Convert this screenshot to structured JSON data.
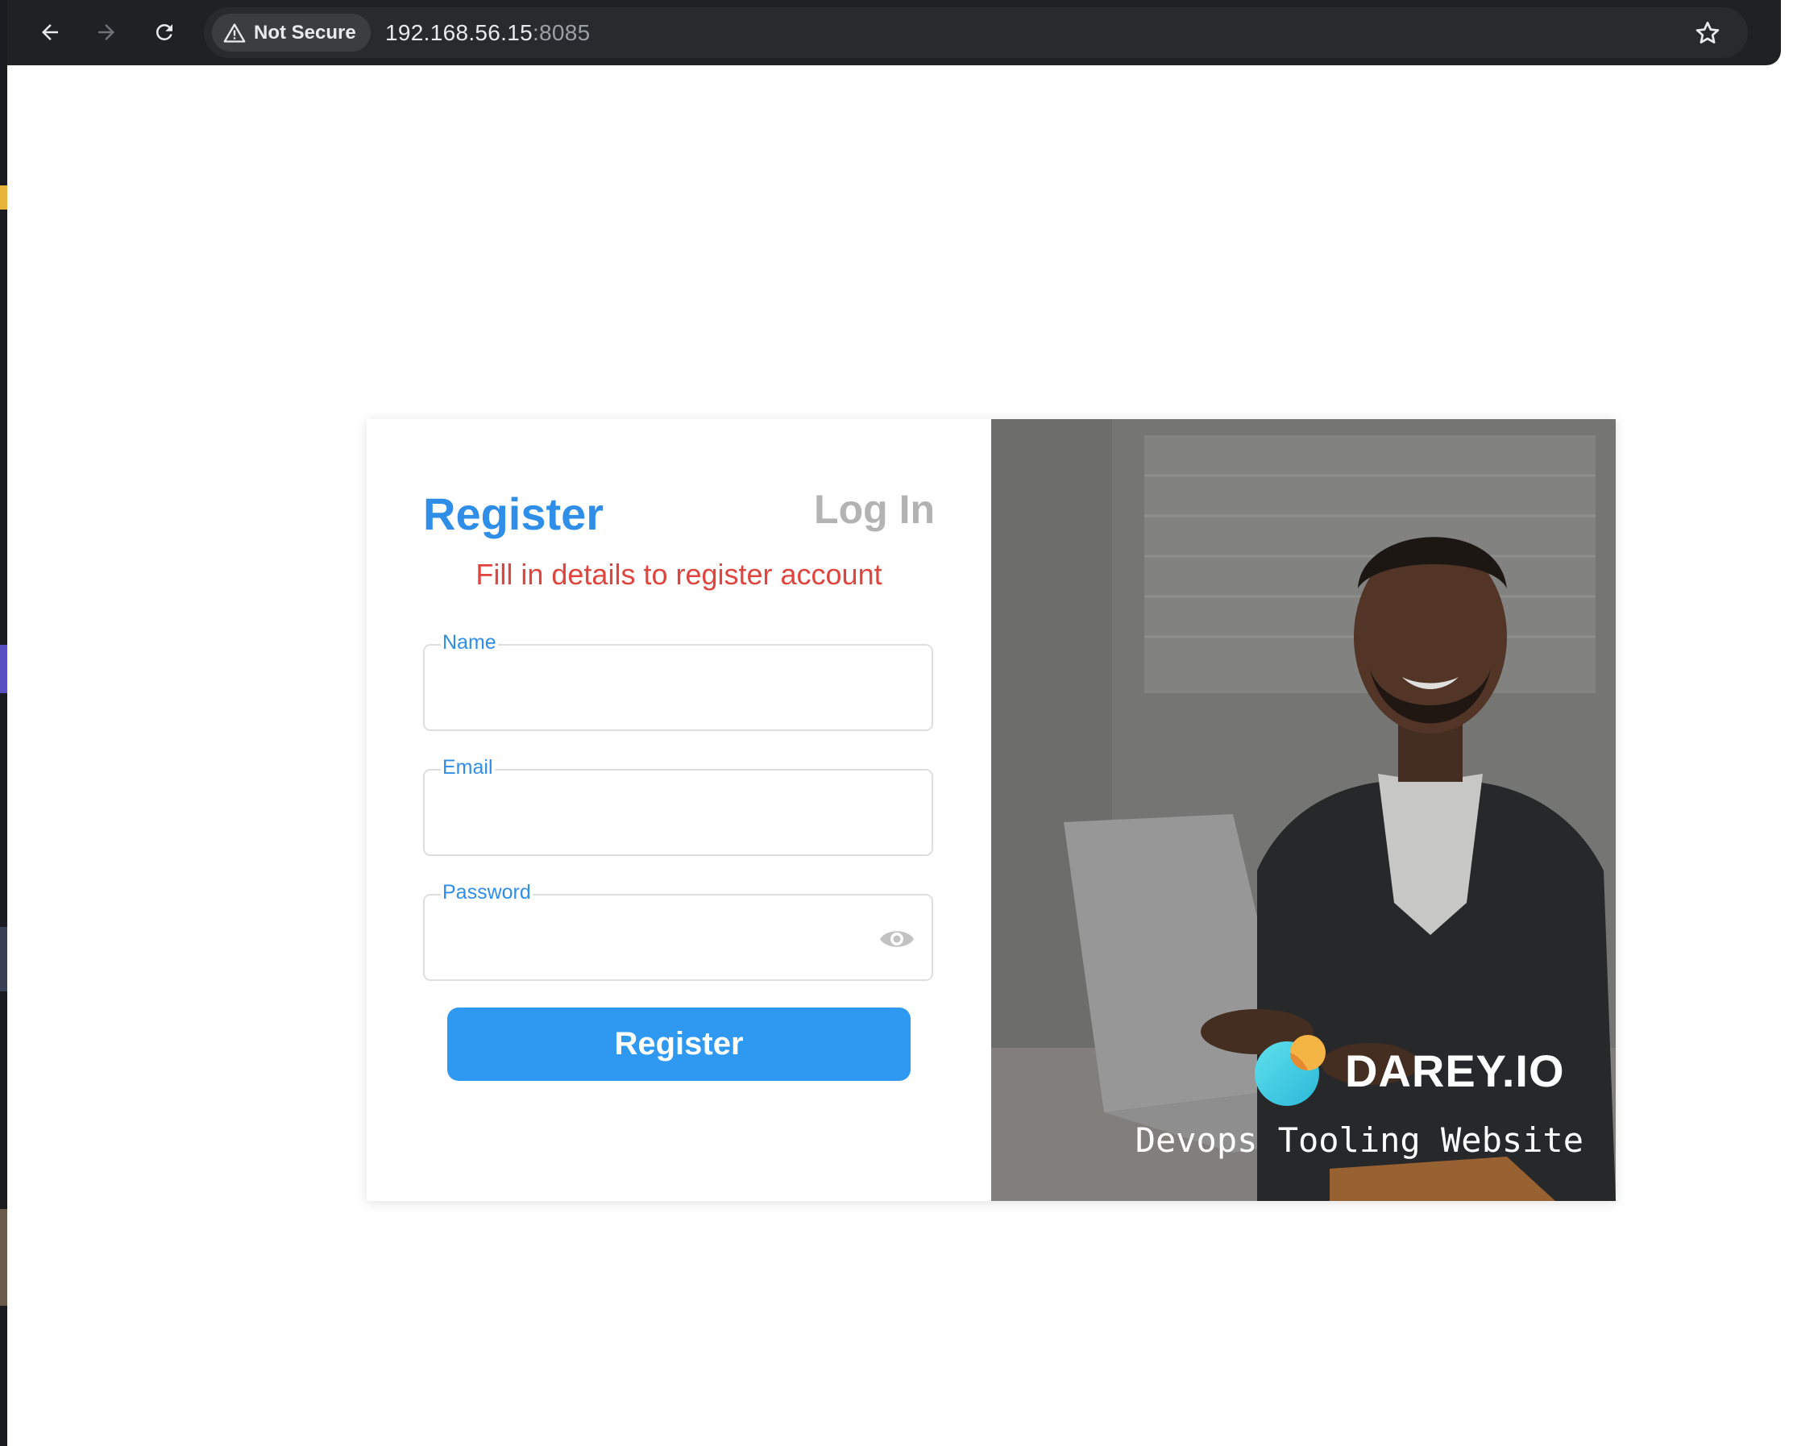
{
  "browser": {
    "security_label": "Not Secure",
    "url_host": "192.168.56.15",
    "url_port": ":8085"
  },
  "form": {
    "title": "Register",
    "login_tab": "Log In",
    "subtitle": "Fill in details to register account",
    "fields": [
      {
        "label": "Name",
        "value": ""
      },
      {
        "label": "Email",
        "value": ""
      },
      {
        "label": "Password",
        "value": ""
      }
    ],
    "submit_label": "Register"
  },
  "promo": {
    "brand": "DAREY.IO",
    "tagline": "Devops Tooling Website"
  },
  "colors": {
    "accent": "#2f8ee8",
    "button": "#2f99f2",
    "error": "#e0443e",
    "muted": "#b3b3b3"
  },
  "icons": [
    "back-arrow-icon",
    "forward-arrow-icon",
    "reload-icon",
    "warning-icon",
    "bookmark-star-icon",
    "eye-icon",
    "darey-logo-icon"
  ]
}
